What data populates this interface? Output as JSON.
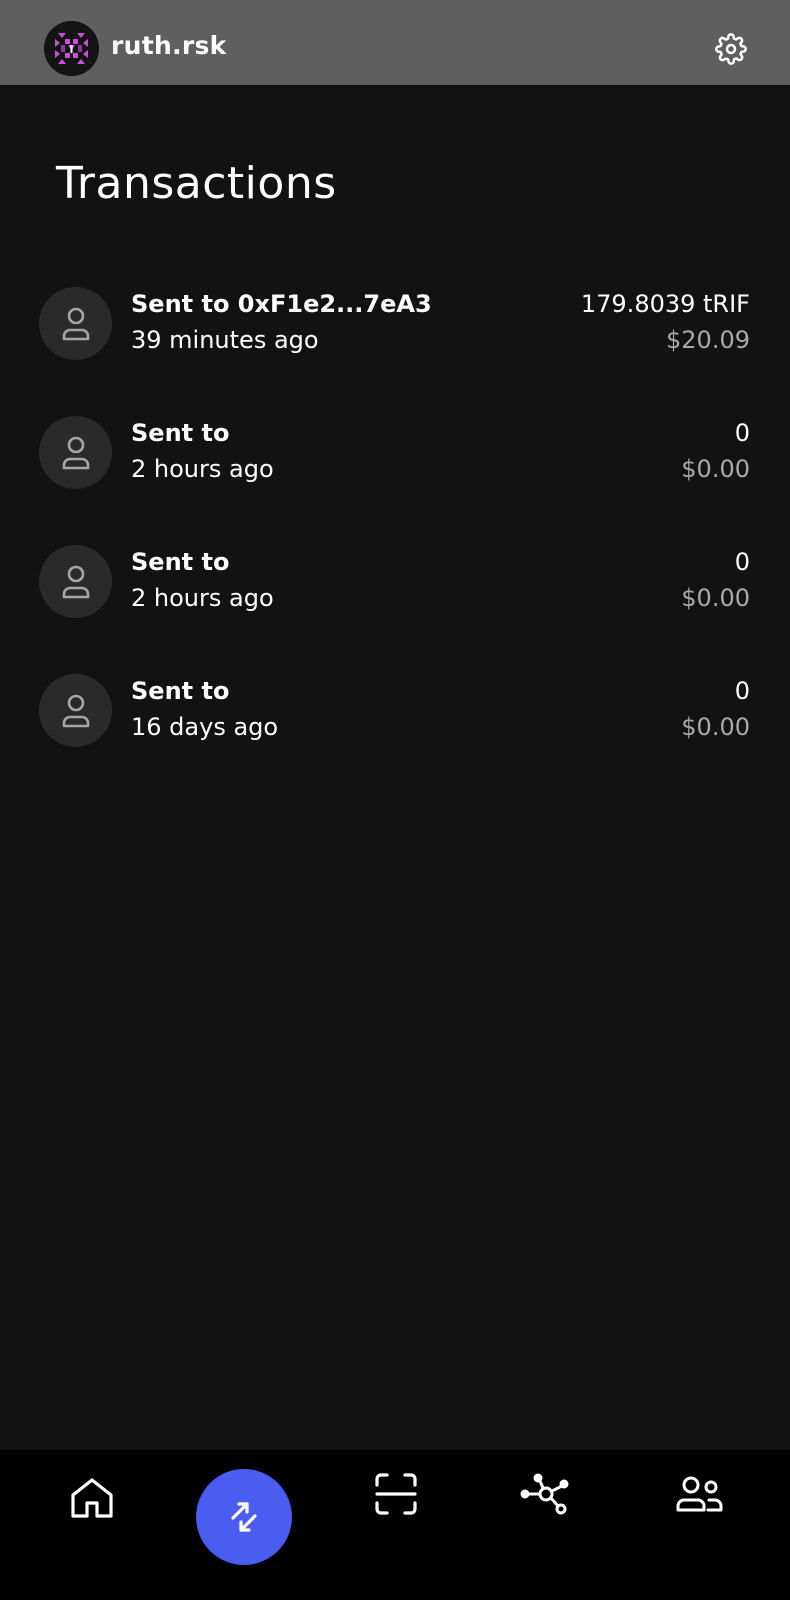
{
  "header": {
    "username": "ruth.rsk",
    "avatar_icon": "identicon-avatar",
    "settings_icon": "gear-icon"
  },
  "page": {
    "title": "Transactions"
  },
  "transactions": [
    {
      "title": "Sent to 0xF1e2...7eA3",
      "time": "39 minutes ago",
      "amount": "179.8039 tRIF",
      "usd": "$20.09",
      "icon": "user-icon"
    },
    {
      "title": "Sent to",
      "time": "2 hours ago",
      "amount": "0",
      "usd": "$0.00",
      "icon": "user-icon"
    },
    {
      "title": "Sent to",
      "time": "2 hours ago",
      "amount": "0",
      "usd": "$0.00",
      "icon": "user-icon"
    },
    {
      "title": "Sent to",
      "time": "16 days ago",
      "amount": "0",
      "usd": "$0.00",
      "icon": "user-icon"
    }
  ],
  "bottom_nav": {
    "items": [
      {
        "icon": "home-icon",
        "active": false
      },
      {
        "icon": "transfer-arrows-icon",
        "active": true
      },
      {
        "icon": "scan-icon",
        "active": false
      },
      {
        "icon": "dapps-network-icon",
        "active": false
      },
      {
        "icon": "contacts-icon",
        "active": false
      }
    ]
  },
  "colors": {
    "background": "#121212",
    "header": "#5f5f5f",
    "accent": "#4b5cf0",
    "secondary_text": "#a9a9a9",
    "icon_circle": "#2a2a2a",
    "nav_background": "#000000"
  }
}
